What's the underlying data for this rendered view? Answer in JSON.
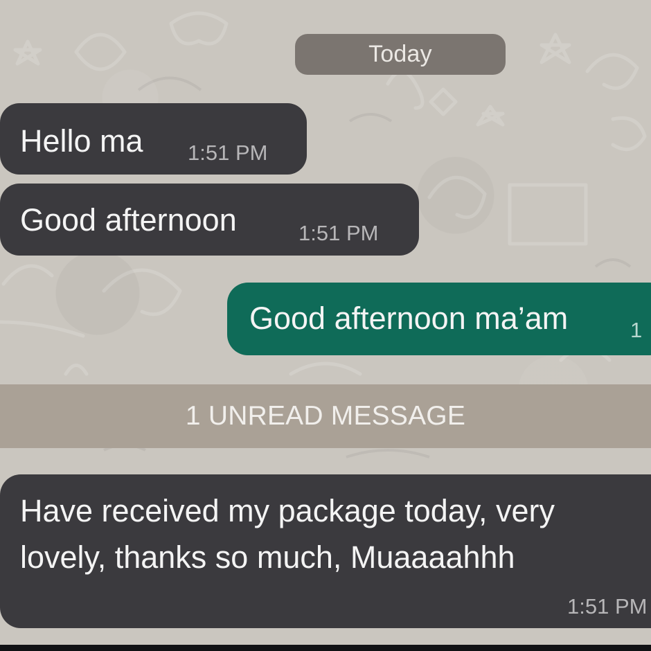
{
  "chat": {
    "date_label": "Today",
    "unread_label": "1 UNREAD MESSAGE",
    "messages": [
      {
        "direction": "incoming",
        "text": "Hello ma",
        "time": "1:51 PM"
      },
      {
        "direction": "incoming",
        "text": "Good afternoon",
        "time": "1:51 PM"
      },
      {
        "direction": "outgoing",
        "text": "Good afternoon ma’am",
        "time": "1"
      },
      {
        "direction": "incoming",
        "line1": "Have received my package today, very",
        "line2": "lovely, thanks so much, Muaaaahhh",
        "time": "1:51 PM"
      }
    ]
  },
  "colors": {
    "background": "#cac6bf",
    "incoming_bubble": "#3b3a3e",
    "outgoing_bubble": "#0f6b58",
    "date_chip": "#7b7570",
    "unread_bar": "#aaa196"
  }
}
